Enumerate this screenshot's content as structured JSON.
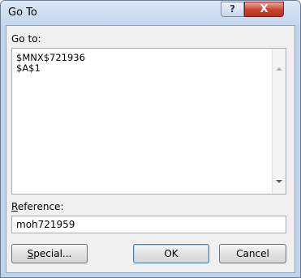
{
  "window": {
    "title": "Go To",
    "help_label": "?",
    "close_label": "X"
  },
  "goto": {
    "label": "Go to:",
    "items": [
      "$MNX$721936",
      "$A$1"
    ]
  },
  "reference": {
    "label_accel": "R",
    "label_rest": "eference:",
    "value": "moh721959"
  },
  "buttons": {
    "special_accel": "S",
    "special_rest": "pecial...",
    "ok": "OK",
    "cancel": "Cancel"
  }
}
